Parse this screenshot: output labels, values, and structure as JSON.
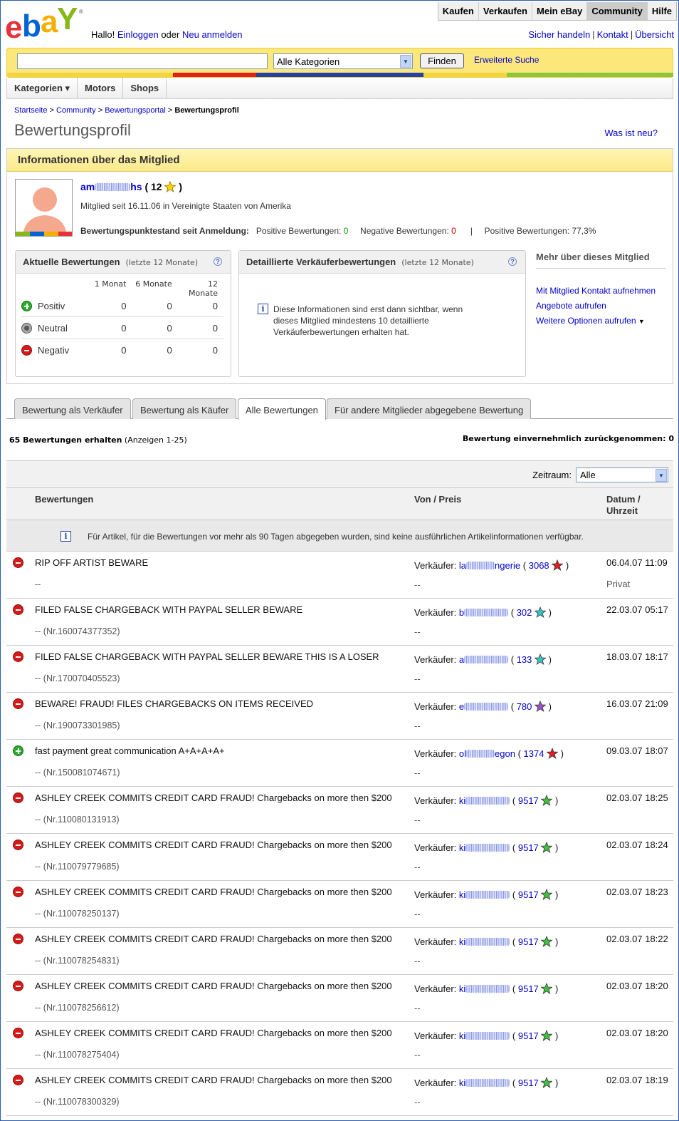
{
  "colors": {
    "positive": "#009900",
    "negative": "#cc0000",
    "link": "#0000cc"
  },
  "header": {
    "greeting_prefix": "Hallo!",
    "login_link": "Einloggen",
    "greeting_or": "oder",
    "register_link": "Neu anmelden",
    "topnav": [
      "Kaufen",
      "Verkaufen",
      "Mein eBay",
      "Community",
      "Hilfe"
    ],
    "toplinks": [
      "Sicher handeln",
      "Kontakt",
      "Übersicht"
    ]
  },
  "search": {
    "value": "",
    "category": "Alle Kategorien",
    "find_label": "Finden",
    "advanced_label": "Erweiterte Suche"
  },
  "catnav": [
    "Kategorien ▾",
    "Motors",
    "Shops"
  ],
  "breadcrumb": [
    "Startseite",
    "Community",
    "Bewertungsportal",
    "Bewertungsprofil"
  ],
  "page_title": "Bewertungsprofil",
  "whats_new": "Was ist neu?",
  "member": {
    "box_title": "Informationen über das Mitglied",
    "name_start": "am",
    "name_end": "hs",
    "score": "( 12",
    "score_close": ")",
    "since": "Mitglied seit 16.11.06 in Vereinigte Staaten von Amerika",
    "points_label": "Bewertungspunktestand seit Anmeldung:",
    "positive_label": "Positive Bewertungen:",
    "positive_value": "0",
    "negative_label": "Negative Bewertungen:",
    "negative_value": "0",
    "sep": "|",
    "percent_label": "Positive Bewertungen: 77,3%"
  },
  "recent": {
    "title": "Aktuelle Bewertungen",
    "subtitle": "(letzte 12 Monate)",
    "columns": [
      "1 Monat",
      "6 Monate",
      "12 Monate"
    ],
    "rows": [
      {
        "label": "Positiv",
        "values": [
          "0",
          "0",
          "0"
        ]
      },
      {
        "label": "Neutral",
        "values": [
          "0",
          "0",
          "0"
        ]
      },
      {
        "label": "Negativ",
        "values": [
          "0",
          "0",
          "0"
        ]
      }
    ]
  },
  "detailed": {
    "title": "Detaillierte Verkäuferbewertungen",
    "subtitle": "(letzte 12 Monate)",
    "message": "Diese Informationen sind erst dann sichtbar, wenn dieses Mitglied mindestens 10 detaillierte Verkäuferbewertungen erhalten hat."
  },
  "more": {
    "title": "Mehr über dieses Mitglied",
    "links": [
      "Mit Mitglied Kontakt aufnehmen",
      "Angebote aufrufen",
      "Weitere Optionen aufrufen"
    ]
  },
  "tabs": [
    "Bewertung als Verkäufer",
    "Bewertung als Käufer",
    "Alle Bewertungen",
    "Für andere Mitglieder abgegebene Bewertung"
  ],
  "summary": {
    "count": "65 Bewertungen erhalten",
    "range": "(Anzeigen 1-25)",
    "withdrawn": "Bewertung einvernehmlich zurückgenommen: 0"
  },
  "table": {
    "period_label": "Zeitraum:",
    "period_value": "Alle",
    "col_feedback": "Bewertungen",
    "col_from": "Von / Preis",
    "col_date": "Datum / Uhrzeit",
    "info": "Für Artikel, für die Bewertungen vor mehr als 90 Tagen abgegeben wurden, sind keine ausführlichen Artikelinformationen verfügbar.",
    "from_prefix": "Verkäufer:",
    "rows": [
      {
        "type": "neg",
        "comment": "RIP OFF ARTIST BEWARE",
        "item": "--",
        "user_start": "la",
        "user_end": "ngerie",
        "score": "3068",
        "star": "red",
        "price": "--",
        "date": "06.04.07 11:09",
        "private": "Privat"
      },
      {
        "type": "neg",
        "comment": "FILED FALSE CHARGEBACK WITH PAYPAL SELLER BEWARE",
        "item": "-- (Nr.160074377352)",
        "user_start": "b",
        "user_end": "",
        "score": "302",
        "star": "turquoise",
        "price": "--",
        "date": "22.03.07 05:17",
        "private": ""
      },
      {
        "type": "neg",
        "comment": "FILED FALSE CHARGEBACK WITH PAYPAL SELLER BEWARE THIS IS A LOSER",
        "item": "-- (Nr.170070405523)",
        "user_start": "a",
        "user_end": "",
        "score": "133",
        "star": "turquoise",
        "price": "--",
        "date": "18.03.07 18:17",
        "private": ""
      },
      {
        "type": "neg",
        "comment": "BEWARE! FRAUD! FILES CHARGEBACKS ON ITEMS RECEIVED",
        "item": "-- (Nr.190073301985)",
        "user_start": "e",
        "user_end": "",
        "score": "780",
        "star": "purple",
        "price": "--",
        "date": "16.03.07 21:09",
        "private": ""
      },
      {
        "type": "pos",
        "comment": "fast payment great communication A+A+A+A+",
        "item": "-- (Nr.150081074671)",
        "user_start": "ol",
        "user_end": "egon",
        "score": "1374",
        "star": "red",
        "price": "--",
        "date": "09.03.07 18:07",
        "private": ""
      },
      {
        "type": "neg",
        "comment": "ASHLEY CREEK COMMITS CREDIT CARD FRAUD! Chargebacks on more then $200",
        "item": "-- (Nr.110080131913)",
        "user_start": "ki",
        "user_end": "",
        "score": "9517",
        "star": "green",
        "price": "--",
        "date": "02.03.07 18:25",
        "private": ""
      },
      {
        "type": "neg",
        "comment": "ASHLEY CREEK COMMITS CREDIT CARD FRAUD! Chargebacks on more then $200",
        "item": "-- (Nr.110079779685)",
        "user_start": "ki",
        "user_end": "",
        "score": "9517",
        "star": "green",
        "price": "--",
        "date": "02.03.07 18:24",
        "private": ""
      },
      {
        "type": "neg",
        "comment": "ASHLEY CREEK COMMITS CREDIT CARD FRAUD! Chargebacks on more then $200",
        "item": "-- (Nr.110078250137)",
        "user_start": "ki",
        "user_end": "",
        "score": "9517",
        "star": "green",
        "price": "--",
        "date": "02.03.07 18:23",
        "private": ""
      },
      {
        "type": "neg",
        "comment": "ASHLEY CREEK COMMITS CREDIT CARD FRAUD! Chargebacks on more then $200",
        "item": "-- (Nr.110078254831)",
        "user_start": "ki",
        "user_end": "",
        "score": "9517",
        "star": "green",
        "price": "--",
        "date": "02.03.07 18:22",
        "private": ""
      },
      {
        "type": "neg",
        "comment": "ASHLEY CREEK COMMITS CREDIT CARD FRAUD! Chargebacks on more then $200",
        "item": "-- (Nr.110078256612)",
        "user_start": "ki",
        "user_end": "",
        "score": "9517",
        "star": "green",
        "price": "--",
        "date": "02.03.07 18:20",
        "private": ""
      },
      {
        "type": "neg",
        "comment": "ASHLEY CREEK COMMITS CREDIT CARD FRAUD! Chargebacks on more then $200",
        "item": "-- (Nr.110078275404)",
        "user_start": "ki",
        "user_end": "",
        "score": "9517",
        "star": "green",
        "price": "--",
        "date": "02.03.07 18:20",
        "private": ""
      },
      {
        "type": "neg",
        "comment": "ASHLEY CREEK COMMITS CREDIT CARD FRAUD! Chargebacks on more then $200",
        "item": "-- (Nr.110078300329)",
        "user_start": "ki",
        "user_end": "",
        "score": "9517",
        "star": "green",
        "price": "--",
        "date": "02.03.07 18:19",
        "private": ""
      }
    ]
  }
}
